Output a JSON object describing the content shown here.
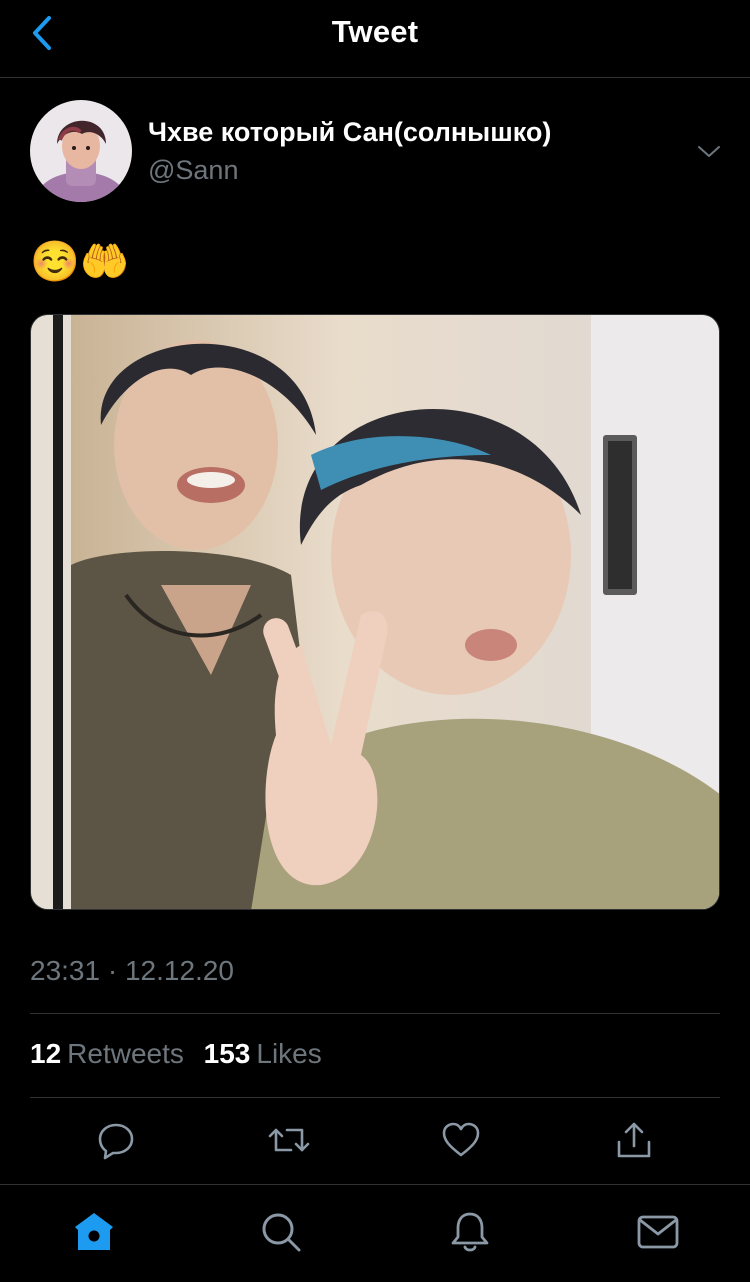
{
  "header": {
    "title": "Tweet",
    "back_icon": "chevron-left-icon"
  },
  "tweet": {
    "author_name": "Чхве который Сан(солнышко)",
    "author_handle": "@Sann",
    "text": "☺️🤲",
    "timestamp": "23:31 · 12.12.20",
    "retweets": {
      "count": "12",
      "label": "Retweets"
    },
    "likes": {
      "count": "153",
      "label": "Likes"
    }
  },
  "actions": [
    "reply-icon",
    "retweet-icon",
    "like-icon",
    "share-icon"
  ],
  "tabbar": [
    "home-icon",
    "search-icon",
    "notifications-icon",
    "messages-icon"
  ],
  "colors": {
    "background": "#000000",
    "accent": "#1d9bf0",
    "secondary_text": "#6e767d",
    "divider": "#2f3336"
  }
}
